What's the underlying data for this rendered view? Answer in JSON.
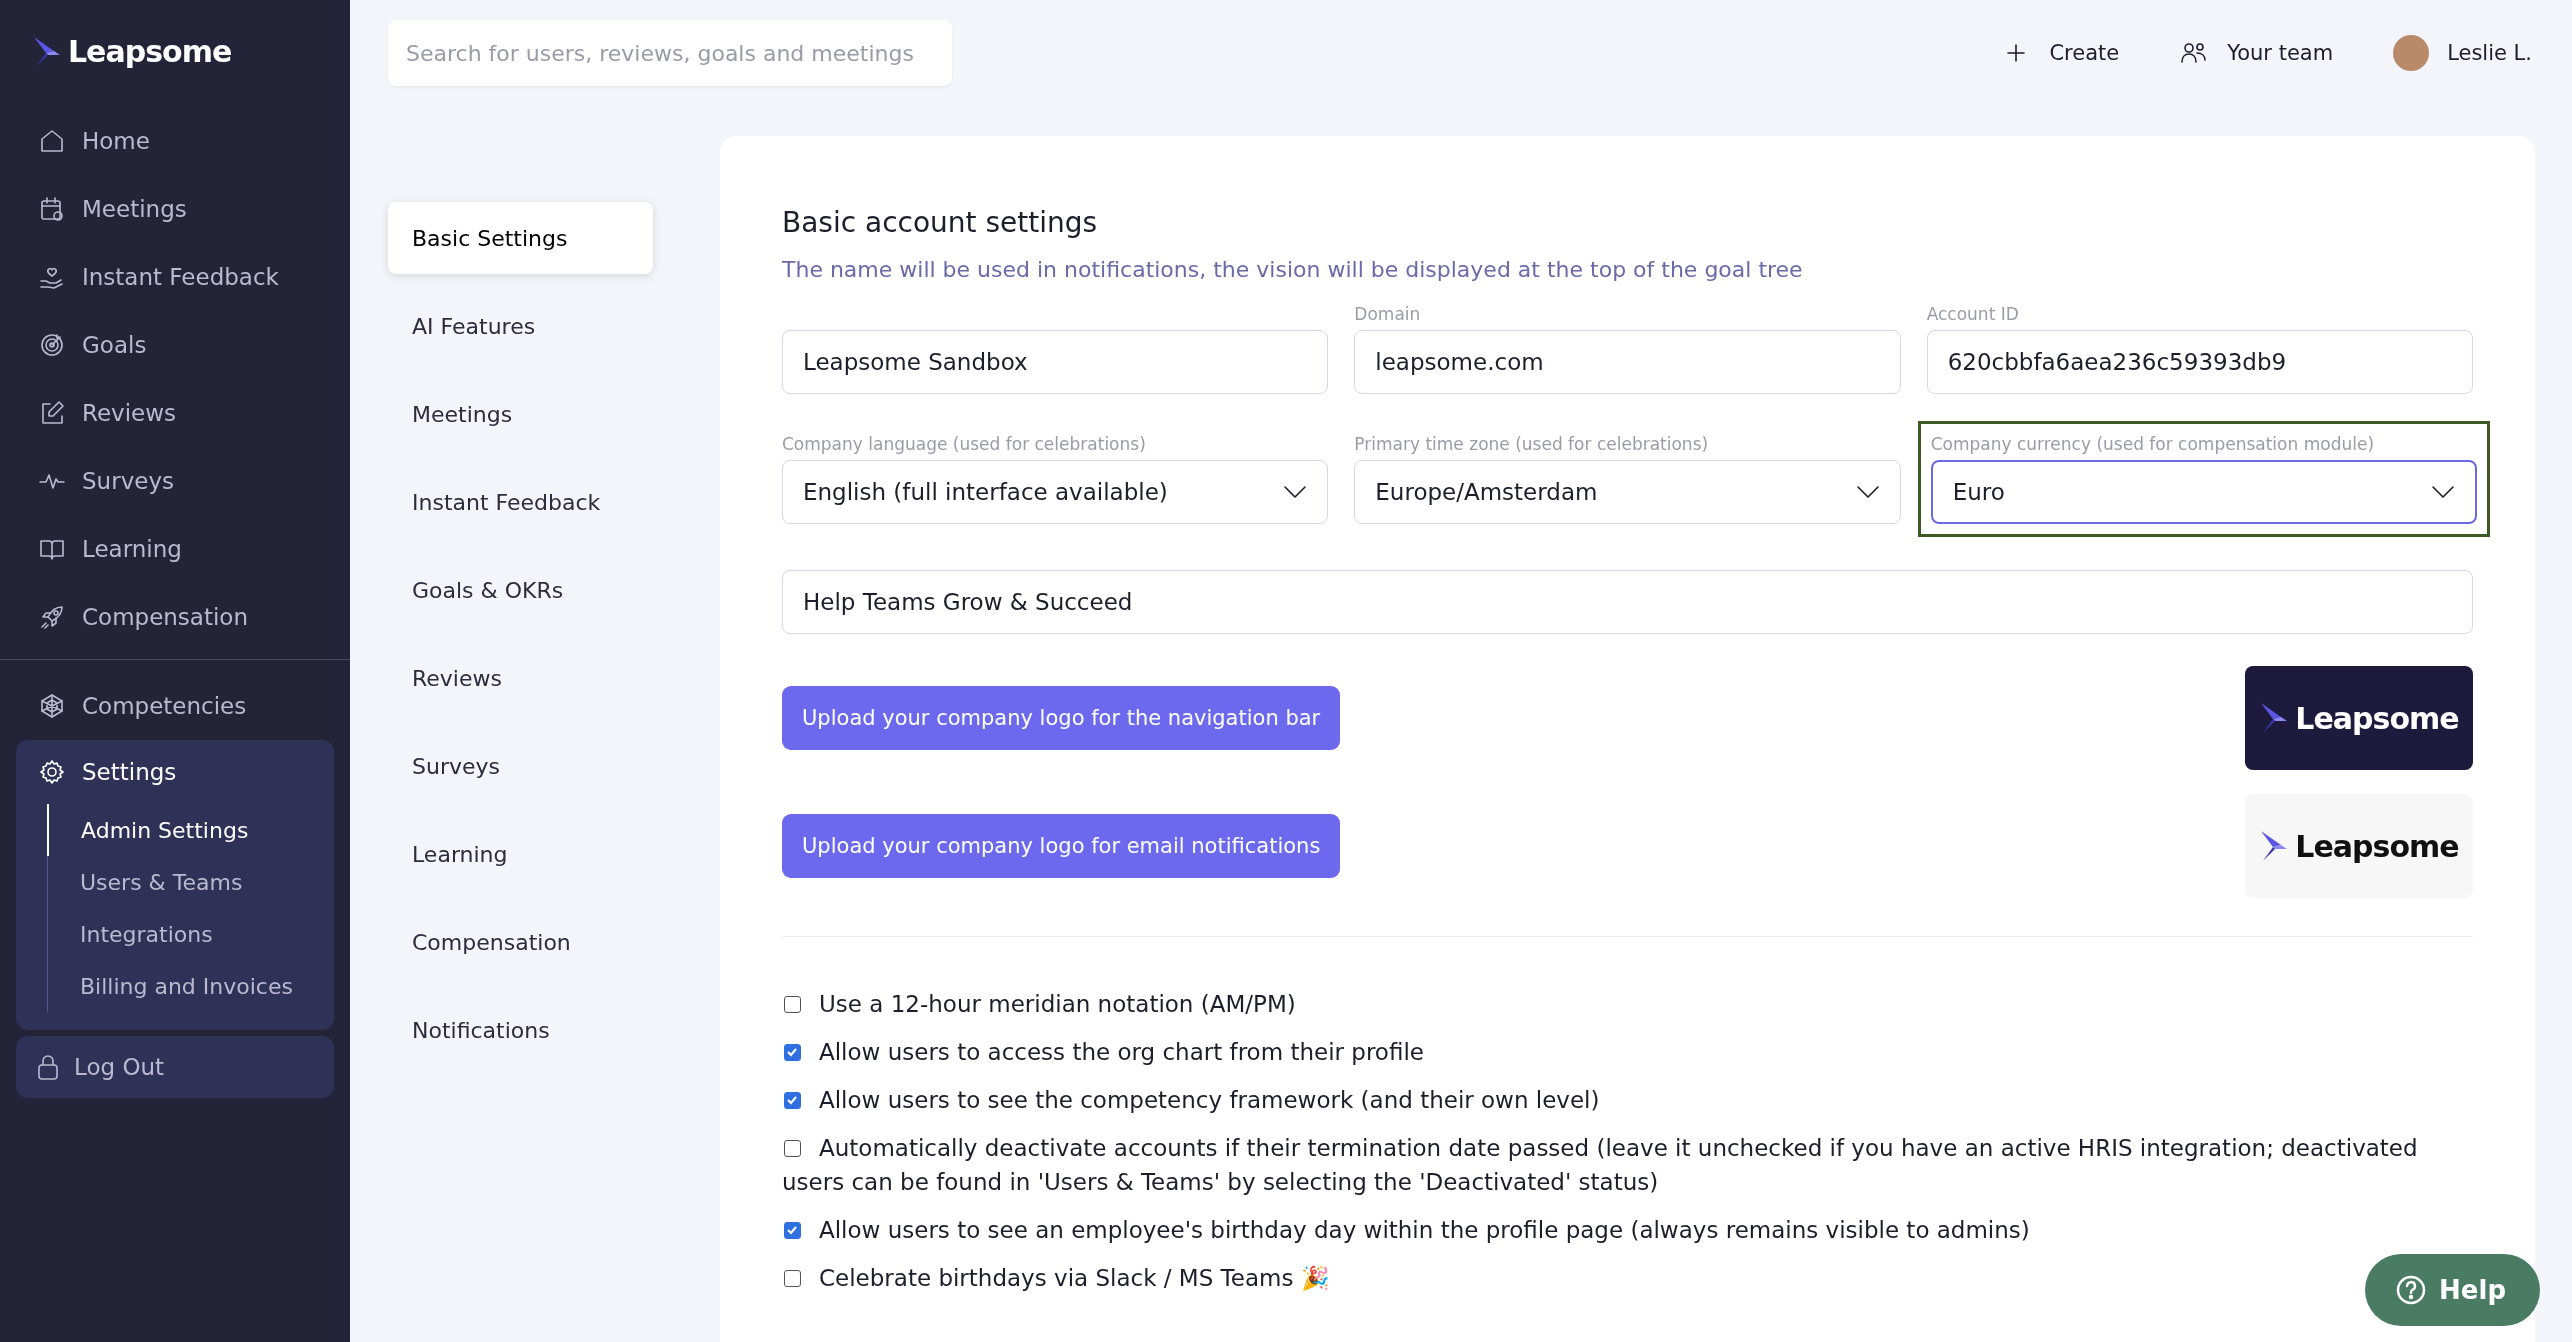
{
  "sidebar": {
    "brand": "Leapsome",
    "items": [
      {
        "label": "Home",
        "selected": false
      },
      {
        "label": "Meetings",
        "selected": false
      },
      {
        "label": "Instant Feedback",
        "selected": false
      },
      {
        "label": "Goals",
        "selected": false
      },
      {
        "label": "Reviews",
        "selected": false
      },
      {
        "label": "Surveys",
        "selected": false
      },
      {
        "label": "Learning",
        "selected": false
      },
      {
        "label": "Compensation",
        "selected": false
      }
    ],
    "lower_items": [
      {
        "label": "Competencies",
        "selected": false
      },
      {
        "label": "Settings",
        "selected": true,
        "expanded": true,
        "children": [
          {
            "label": "Admin Settings",
            "selected": true
          },
          {
            "label": "Users & Teams",
            "selected": false
          },
          {
            "label": "Integrations",
            "selected": false
          },
          {
            "label": "Billing and Invoices",
            "selected": false
          }
        ]
      }
    ],
    "logout": "Log Out"
  },
  "topbar": {
    "search": {
      "placeholder": "Search for users, reviews, goals and meetings"
    },
    "create": "Create",
    "team": "Your team",
    "user": "Leslie L."
  },
  "settings_nav": [
    {
      "label": "Basic Settings",
      "selected": true
    },
    {
      "label": "AI Features",
      "selected": false
    },
    {
      "label": "Meetings",
      "selected": false
    },
    {
      "label": "Instant Feedback",
      "selected": false
    },
    {
      "label": "Goals & OKRs",
      "selected": false
    },
    {
      "label": "Reviews",
      "selected": false
    },
    {
      "label": "Surveys",
      "selected": false
    },
    {
      "label": "Learning",
      "selected": false
    },
    {
      "label": "Compensation",
      "selected": false
    },
    {
      "label": "Notifications",
      "selected": false
    }
  ],
  "card": {
    "title": "Basic account settings",
    "description": "The name will be used in notifications, the vision will be displayed at the top of the goal tree",
    "fields": [
      {
        "kind": "text",
        "value": "Leapsome Sandbox",
        "highlighted": false
      },
      {
        "kind": "text",
        "label": "Domain",
        "value": "leapsome.com",
        "highlighted": false
      },
      {
        "kind": "text",
        "label": "Account ID",
        "value": "620cbbfa6aea236c59393db9",
        "highlighted": false
      },
      {
        "kind": "select",
        "label": "Company language (used for celebrations)",
        "value": "English (full interface available)",
        "highlighted": false
      },
      {
        "kind": "select",
        "label": "Primary time zone (used for celebrations)",
        "value": "Europe/Amsterdam",
        "highlighted": false
      },
      {
        "kind": "select",
        "label": "Company currency (used for compensation module)",
        "value": "Euro",
        "highlighted": true
      }
    ],
    "vision": {
      "value": "Help Teams Grow & Succeed"
    },
    "uploads": [
      {
        "button": "Upload your company logo for the navigation bar",
        "preview": "Leapsome"
      },
      {
        "button": "Upload your company logo for email notifications",
        "preview": "Leapsome"
      }
    ],
    "options": [
      {
        "label": "Use a 12-hour meridian notation (AM/PM)",
        "checked": false
      },
      {
        "label": "Allow users to access the org chart from their profile",
        "checked": true
      },
      {
        "label": "Allow users to see the competency framework (and their own level)",
        "checked": true
      },
      {
        "label": "Automatically deactivate accounts if their termination date passed (leave it unchecked if you have an active HRIS integration; deactivated users can be found in 'Users & Teams' by selecting the 'Deactivated' status)",
        "checked": false
      },
      {
        "label": "Allow users to see an employee's birthday day within the profile page (always remains visible to admins)",
        "checked": true
      },
      {
        "label": "Celebrate birthdays via Slack / MS Teams 🎉",
        "checked": false
      }
    ]
  },
  "help": "Help"
}
